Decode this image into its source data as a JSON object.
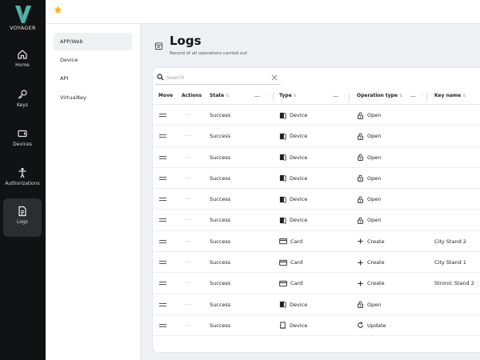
{
  "brand": {
    "name": "VOYAGER",
    "accent": "#4fb3a9"
  },
  "rail": [
    {
      "label": "Home",
      "icon": "home-icon"
    },
    {
      "label": "Keys",
      "icon": "key-icon"
    },
    {
      "label": "Devices",
      "icon": "device-icon"
    },
    {
      "label": "Authorizations",
      "icon": "person-icon"
    },
    {
      "label": "Logs",
      "icon": "document-icon",
      "active": true
    }
  ],
  "topbar": {
    "favorite_icon": "star-icon",
    "favorite_color": "#f6b800"
  },
  "submenu": [
    {
      "label": "APP/Web",
      "active": true
    },
    {
      "label": "Device"
    },
    {
      "label": "API"
    },
    {
      "label": "VirtualKey"
    }
  ],
  "page": {
    "title": "Logs",
    "subtitle": "Record of all operations carried out"
  },
  "search": {
    "placeholder": "Search",
    "value": ""
  },
  "columns": {
    "move": "Move",
    "actions": "Actions",
    "state": "State",
    "type": "Type",
    "operation": "Operation type",
    "key": "Key name"
  },
  "rows": [
    {
      "state": "Success",
      "type": "Device",
      "type_icon": "door-icon",
      "operation": "Open",
      "op_icon": "unlock-icon",
      "key": ""
    },
    {
      "state": "Success",
      "type": "Device",
      "type_icon": "door-icon",
      "operation": "Open",
      "op_icon": "unlock-icon",
      "key": ""
    },
    {
      "state": "Success",
      "type": "Device",
      "type_icon": "door-icon",
      "operation": "Open",
      "op_icon": "unlock-icon",
      "key": ""
    },
    {
      "state": "Success",
      "type": "Device",
      "type_icon": "door-icon",
      "operation": "Open",
      "op_icon": "unlock-icon",
      "key": ""
    },
    {
      "state": "Success",
      "type": "Device",
      "type_icon": "door-icon",
      "operation": "Open",
      "op_icon": "unlock-icon",
      "key": ""
    },
    {
      "state": "Success",
      "type": "Device",
      "type_icon": "door-icon",
      "operation": "Open",
      "op_icon": "unlock-icon",
      "key": ""
    },
    {
      "state": "Success",
      "type": "Card",
      "type_icon": "card-icon",
      "operation": "Create",
      "op_icon": "plus-icon",
      "key": "City Stand 2"
    },
    {
      "state": "Success",
      "type": "Card",
      "type_icon": "card-icon",
      "operation": "Create",
      "op_icon": "plus-icon",
      "key": "City Stand 1"
    },
    {
      "state": "Success",
      "type": "Card",
      "type_icon": "card-icon",
      "operation": "Create",
      "op_icon": "plus-icon",
      "key": "Stronic Stand 2"
    },
    {
      "state": "Success",
      "type": "Device",
      "type_icon": "door-icon",
      "operation": "Open",
      "op_icon": "unlock-icon",
      "key": ""
    },
    {
      "state": "Success",
      "type": "Device",
      "type_icon": "door-outline-icon",
      "operation": "Update",
      "op_icon": "refresh-icon",
      "key": ""
    }
  ]
}
